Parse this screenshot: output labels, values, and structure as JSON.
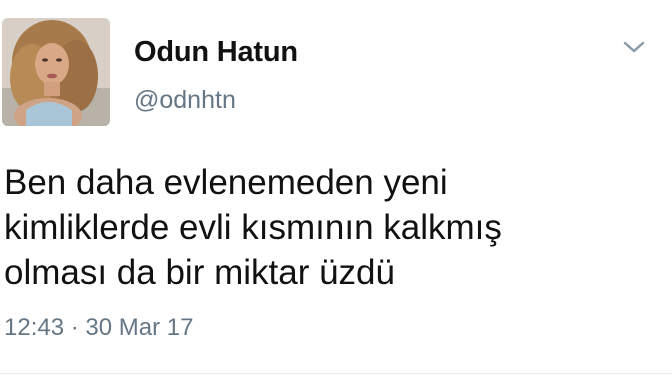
{
  "tweet": {
    "author": {
      "display_name": "Odun Hatun",
      "handle": "@odnhtn"
    },
    "menu_icon": "chevron-down-icon",
    "text_lines": [
      "Ben daha evlenemeden yeni",
      "kimliklerde evli kısmının kalkmış",
      "olması da bir miktar üzdü"
    ],
    "timestamp": "12:43 · 30 Mar 17"
  },
  "colors": {
    "secondary_text": "#657786",
    "primary_text": "#14171a",
    "divider": "#e6ecf0"
  }
}
